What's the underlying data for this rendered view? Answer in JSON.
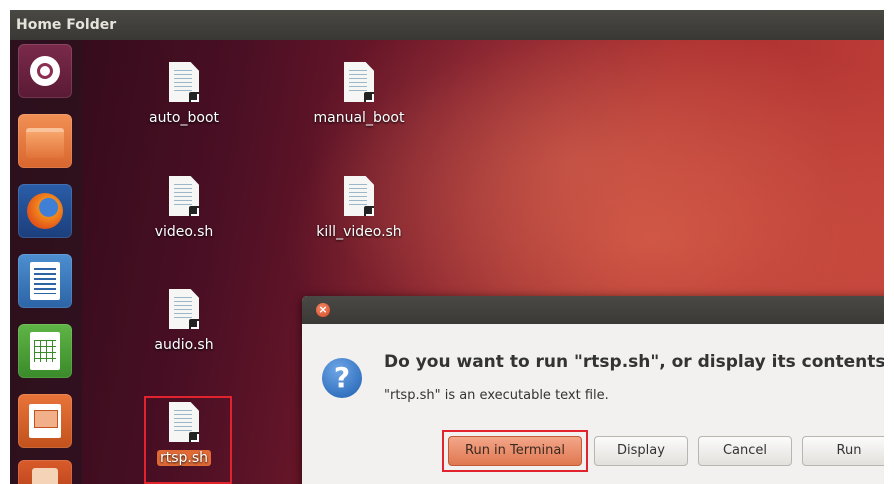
{
  "topbar": {
    "title": "Home Folder"
  },
  "launcher": {
    "items": [
      {
        "name": "dash",
        "icon": "ubuntu-logo-icon"
      },
      {
        "name": "files",
        "icon": "folder-icon"
      },
      {
        "name": "firefox",
        "icon": "firefox-icon"
      },
      {
        "name": "writer",
        "icon": "text-document-icon"
      },
      {
        "name": "calc",
        "icon": "spreadsheet-icon"
      },
      {
        "name": "impress",
        "icon": "presentation-icon"
      },
      {
        "name": "software-center",
        "icon": "shopping-bag-icon"
      }
    ]
  },
  "desktop": {
    "files": [
      {
        "label": "auto_boot"
      },
      {
        "label": "manual_boot"
      },
      {
        "label": "video.sh"
      },
      {
        "label": "kill_video.sh"
      },
      {
        "label": "audio.sh"
      },
      {
        "label": "rtsp.sh"
      }
    ]
  },
  "dialog": {
    "heading": "Do you want to run \"rtsp.sh\", or display its contents?",
    "subtext": "\"rtsp.sh\" is an executable text file.",
    "question_glyph": "?",
    "close_glyph": "×",
    "buttons": {
      "run_in_terminal": "Run in Terminal",
      "display": "Display",
      "cancel": "Cancel",
      "run": "Run"
    }
  },
  "colors": {
    "highlight": "#e0232d",
    "accent": "#e07850"
  }
}
